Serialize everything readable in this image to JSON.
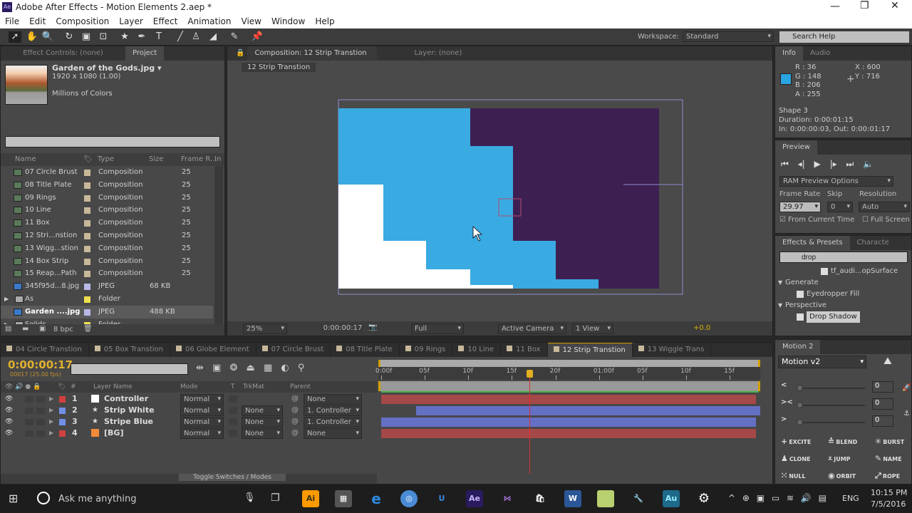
{
  "window": {
    "title": "Adobe After Effects - Motion Elements 2.aep *",
    "app_icon": "Ae"
  },
  "menu": [
    "File",
    "Edit",
    "Composition",
    "Layer",
    "Effect",
    "Animation",
    "View",
    "Window",
    "Help"
  ],
  "toolbar": {
    "workspace_label": "Workspace:",
    "workspace_value": "Standard",
    "search_help": "Search Help"
  },
  "project": {
    "tabs": [
      "Effect Controls: (none)",
      "Project"
    ],
    "selected_name": "Garden of the Gods.jpg ▾",
    "selected_dims": "1920 x 1080 (1.00)",
    "selected_colors": "Millions of Colors",
    "columns": [
      "Name",
      "Type",
      "Size",
      "Frame R...",
      "In P"
    ],
    "items": [
      {
        "name": "07 Circle Brust",
        "type": "Composition",
        "size": "",
        "fps": "25",
        "color": "#c8b89a",
        "kind": "comp"
      },
      {
        "name": "08 Title Plate",
        "type": "Composition",
        "size": "",
        "fps": "25",
        "color": "#c8b89a",
        "kind": "comp"
      },
      {
        "name": "09 Rings",
        "type": "Composition",
        "size": "",
        "fps": "25",
        "color": "#c8b89a",
        "kind": "comp"
      },
      {
        "name": "10 Line",
        "type": "Composition",
        "size": "",
        "fps": "25",
        "color": "#c8b89a",
        "kind": "comp"
      },
      {
        "name": "11 Box",
        "type": "Composition",
        "size": "",
        "fps": "25",
        "color": "#c8b89a",
        "kind": "comp"
      },
      {
        "name": "12 Stri...nstion",
        "type": "Composition",
        "size": "",
        "fps": "25",
        "color": "#c8b89a",
        "kind": "comp"
      },
      {
        "name": "13 Wigg...stion",
        "type": "Composition",
        "size": "",
        "fps": "25",
        "color": "#c8b89a",
        "kind": "comp"
      },
      {
        "name": "14 Box Strip",
        "type": "Composition",
        "size": "",
        "fps": "25",
        "color": "#c8b89a",
        "kind": "comp"
      },
      {
        "name": "15 Reap...Path",
        "type": "Composition",
        "size": "",
        "fps": "25",
        "color": "#c8b89a",
        "kind": "comp"
      },
      {
        "name": "345f95d...8.jpg",
        "type": "JPEG",
        "size": "68 KB",
        "fps": "",
        "color": "#b8b8e8",
        "kind": "jpeg"
      },
      {
        "name": "As",
        "type": "Folder",
        "size": "",
        "fps": "",
        "color": "#f0e050",
        "kind": "folder"
      },
      {
        "name": "Garden ....jpg",
        "type": "JPEG",
        "size": "488 KB",
        "fps": "",
        "color": "#b8b8e8",
        "kind": "jpeg"
      },
      {
        "name": "Solids",
        "type": "Folder",
        "size": "",
        "fps": "",
        "color": "#f0e050",
        "kind": "folder"
      }
    ],
    "bpc": "8 bpc"
  },
  "composition": {
    "tab": "Composition: 12 Strip Transtion",
    "layer_tab": "Layer: (none)",
    "breadcrumb": "12 Strip Transtion",
    "zoom": "25%",
    "timecode": "0:00:00:17",
    "resolution": "Full",
    "camera": "Active Camera",
    "views": "1 View",
    "exposure": "+0.0",
    "colors": {
      "blue": "#3aaae2",
      "purple": "#3e1f52",
      "white": "#ffffff"
    }
  },
  "info": {
    "tabs": [
      "Info",
      "Audio"
    ],
    "r": "R : 36",
    "g": "G : 148",
    "b": "B : 206",
    "a": "A : 255",
    "x": "X : 600",
    "y": "Y : 716",
    "swatch": "#2494ce",
    "layer": "Shape 3",
    "duration": "Duration: 0:00:01:15",
    "inout": "In: 0:00:00:03, Out: 0:00:01:17"
  },
  "preview": {
    "tab": "Preview",
    "ram": "RAM Preview Options",
    "frame_rate_label": "Frame Rate",
    "skip_label": "Skip",
    "resolution_label": "Resolution",
    "frame_rate": "29.97",
    "skip": "0",
    "resolution": "Auto",
    "from_current": "From Current Time",
    "from_current_checked": true,
    "full_screen": "Full Screen",
    "full_screen_checked": false
  },
  "effects": {
    "tabs": [
      "Effects & Presets",
      "Characte"
    ],
    "search": "drop",
    "items": [
      {
        "label": "tf_audi...opSurface",
        "level": 2
      },
      {
        "label": "Generate",
        "level": 0
      },
      {
        "label": "Eyedropper Fill",
        "level": 1
      },
      {
        "label": "Perspective",
        "level": 0
      },
      {
        "label": "Drop Shadow",
        "level": 1,
        "selected": true
      }
    ]
  },
  "timeline": {
    "tabs": [
      "04 Circle Transtion",
      "05 Box Transtion",
      "06 Globe Element",
      "07 Circle Brust",
      "08 Title Plate",
      "09 Rings",
      "10 Line",
      "11 Box",
      "12 Strip Transtion",
      "13 Wiggle Trans"
    ],
    "active_tab": 8,
    "timecode": "0:00:00:17",
    "frame_info": "00017 (25.00 fps)",
    "columns": {
      "layer_name": "Layer Name",
      "mode": "Mode",
      "t": "T",
      "trkmat": "TrkMat",
      "parent": "Parent",
      "num": "#"
    },
    "ruler": [
      "0:00f",
      "05f",
      "10f",
      "15f",
      "20f",
      "01:00f",
      "05f",
      "10f",
      "15f"
    ],
    "current_frame": 17,
    "layers": [
      {
        "num": "1",
        "name": "Controller",
        "label": "#d04040",
        "icon": "solid-white",
        "mode": "Normal",
        "trkmat": "",
        "parent": "None",
        "bar_color": "#a54848",
        "bar_start": 0,
        "bar_end": 43
      },
      {
        "num": "2",
        "name": "Strip White",
        "label": "#7090e8",
        "icon": "star",
        "mode": "Normal",
        "trkmat": "None",
        "parent": "1. Controller",
        "bar_color": "#6470c4",
        "bar_start": 4,
        "bar_end": 43
      },
      {
        "num": "3",
        "name": "Stripe Blue",
        "label": "#7090e8",
        "icon": "star",
        "mode": "Normal",
        "trkmat": "None",
        "parent": "1. Controller",
        "bar_color": "#6470c4",
        "bar_start": 0,
        "bar_end": 43
      },
      {
        "num": "4",
        "name": "[BG]",
        "label": "#d04040",
        "icon": "solid-orange",
        "mode": "Normal",
        "trkmat": "None",
        "parent": "None",
        "bar_color": "#a54848",
        "bar_start": 0,
        "bar_end": 43
      }
    ],
    "toggle": "Toggle Switches / Modes"
  },
  "motion": {
    "tab": "Motion 2",
    "preset": "Motion v2",
    "sliders": [
      {
        "icon": "<",
        "value": "0"
      },
      {
        "icon": "><",
        "value": "0"
      },
      {
        "icon": ">",
        "value": "0"
      }
    ],
    "buttons": [
      "EXCITE",
      "BLEND",
      "BURST",
      "CLONE",
      "JUMP",
      "NAME",
      "NULL",
      "ORBIT",
      "ROPE"
    ]
  },
  "taskbar": {
    "search": "Ask me anything",
    "lang": "ENG",
    "time": "10:15 PM",
    "date": "7/5/2016"
  }
}
